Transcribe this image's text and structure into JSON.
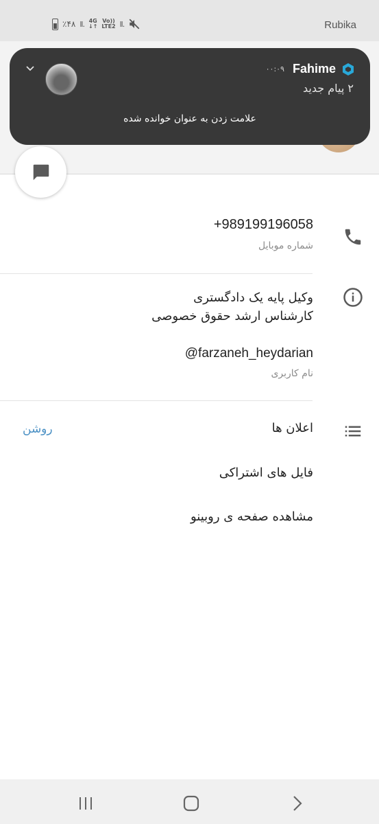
{
  "status_bar": {
    "battery": "٪۴۸",
    "network_top": "4G",
    "network_bottom": "LTE2",
    "volte": "Vo))",
    "signal1": "ll.",
    "signal2": "ll.",
    "app_name": "Rubika"
  },
  "notification": {
    "sender": "Fahime",
    "time": "۰۰:۰۹",
    "count_text": "۲ پیام جدید",
    "action_label": "علامت زدن به عنوان خوانده شده",
    "app_icon": "rubika-hexagon-icon",
    "accent_color": "#29a8d8"
  },
  "contact": {
    "phone": "+989199196058",
    "phone_label": "شماره موبایل",
    "bio_line1": "وکیل پایه یک دادگستری",
    "bio_line2": "کارشناس ارشد حقوق خصوصی",
    "username": "@farzaneh_heydarian",
    "username_label": "نام کاربری"
  },
  "settings": {
    "notifications_label": "اعلان ها",
    "notifications_value": "روشن",
    "shared_files_label": "فایل های اشتراکی",
    "rubino_page_label": "مشاهده صفحه ی روبینو"
  },
  "colors": {
    "accent": "#4a90c4",
    "notification_bg": "#383838",
    "icon_gray": "#5a5a5a"
  }
}
